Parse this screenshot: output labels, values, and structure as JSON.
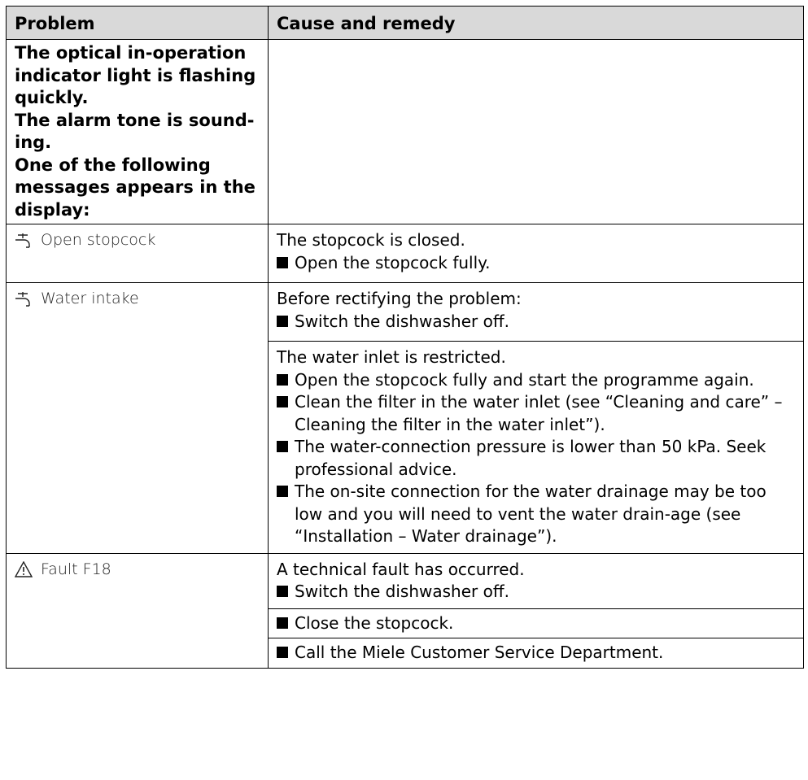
{
  "headers": {
    "problem": "Problem",
    "cause": "Cause and remedy"
  },
  "intro": {
    "lines": [
      "The optical in-operation indicator light is flashing quickly.",
      "The alarm tone is sound-ing.",
      "One of the following messages appears in the display:"
    ]
  },
  "rows": [
    {
      "message": "Open stopcock",
      "icon": "tap-icon",
      "causes": [
        {
          "text": "The stopcock is closed.",
          "items": [
            "Open the stopcock fully."
          ]
        }
      ]
    },
    {
      "message": "Water intake",
      "icon": "tap-icon",
      "causes": [
        {
          "text": "Before rectifying the problem:",
          "items": [
            "Switch the dishwasher off."
          ]
        },
        {
          "text": "The water inlet is restricted.",
          "items": [
            "Open the stopcock fully and start the programme again.",
            "Clean the filter in the water inlet (see “Cleaning and care” – Cleaning the filter in the water inlet”).",
            "The water-connection pressure is lower than 50 kPa. Seek professional advice.",
            "The on-site connection for the water drainage may be too low and you will need to vent the water drain-age (see “Installation – Water drainage”)."
          ]
        }
      ]
    },
    {
      "message": "Fault F18",
      "icon": "warning-icon",
      "causes": [
        {
          "text": "A technical fault has occurred.",
          "items": [
            "Switch the dishwasher off."
          ]
        },
        {
          "text": "",
          "items": [
            "Close the stopcock."
          ]
        },
        {
          "text": "",
          "items": [
            "Call the Miele Customer Service Department."
          ]
        }
      ]
    }
  ]
}
